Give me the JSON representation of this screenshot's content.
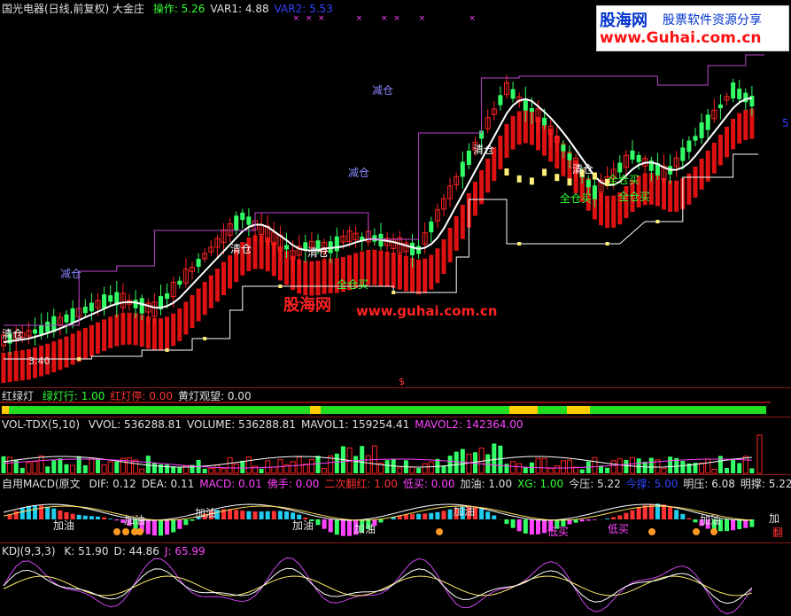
{
  "main_chart": {
    "title": "国光电器(日线,前复权) 大金庄",
    "indicators": [
      {
        "label": "操作: 5.26",
        "color": "#33ff33"
      },
      {
        "label": "VAR1: 4.88",
        "color": "#e0e0e0"
      },
      {
        "label": "VAR2: 5.53",
        "color": "#3344ff"
      }
    ],
    "right_price": "5",
    "low_marker": "3.40",
    "date_marker": "$",
    "annotations": [
      {
        "text": "清仓",
        "color": "#ffffff"
      },
      {
        "text": "减仓",
        "color": "#8888ff"
      },
      {
        "text": "清仓",
        "color": "#ffffff"
      },
      {
        "text": "清仓",
        "color": "#ffffff"
      },
      {
        "text": "全仓买",
        "color": "#33ff33"
      },
      {
        "text": "减仓",
        "color": "#8888ff"
      },
      {
        "text": "减仓",
        "color": "#8888ff"
      },
      {
        "text": "清仓",
        "color": "#ffffff"
      },
      {
        "text": "清仓",
        "color": "#ffffff"
      },
      {
        "text": "全仓买",
        "color": "#33ff33"
      },
      {
        "text": "全仓买",
        "color": "#33ff33"
      },
      {
        "text": "全仓买",
        "color": "#33ff33"
      }
    ]
  },
  "watermark": {
    "logo_cn": "股海网",
    "logo_slogan": "股票软件资源分享",
    "logo_url": "www.Guhai.com.cn",
    "center_cn": "股海网",
    "center_url": "www.guhai.com.cn"
  },
  "light_panel": {
    "title": "红绿灯",
    "items": [
      {
        "label": "绿灯行: 1.00",
        "color": "#33ff33"
      },
      {
        "label": "红灯停: 0.00",
        "color": "#ff3333"
      },
      {
        "label": "黄灯观望: 0.00",
        "color": "#e0e0e0"
      }
    ]
  },
  "vol_panel": {
    "title": "VOL-TDX(5,10)",
    "items": [
      {
        "label": "VVOL: 536288.81",
        "color": "#e0e0e0"
      },
      {
        "label": "VOLUME: 536288.81",
        "color": "#e0e0e0"
      },
      {
        "label": "MAVOL1: 159254.41",
        "color": "#e0e0e0"
      },
      {
        "label": "MAVOL2: 142364.00",
        "color": "#ff44ff"
      }
    ]
  },
  "macd_panel": {
    "title": "自用MACD(原文",
    "items": [
      {
        "label": "DIF: 0.12",
        "color": "#e0e0e0"
      },
      {
        "label": "DEA: 0.11",
        "color": "#e0e0e0"
      },
      {
        "label": "MACD: 0.01",
        "color": "#ff44ff"
      },
      {
        "label": "佛手: 0.00",
        "color": "#ff44ff"
      },
      {
        "label": "二次翻红: 1.00",
        "color": "#ff3333"
      },
      {
        "label": "低买: 0.00",
        "color": "#ff44ff"
      },
      {
        "label": "加油: 1.00",
        "color": "#e0e0e0"
      },
      {
        "label": "XG: 1.00",
        "color": "#33ff33"
      },
      {
        "label": "今压: 5.22",
        "color": "#e0e0e0"
      },
      {
        "label": "今撑: 5.00",
        "color": "#3344ff"
      },
      {
        "label": "明压: 6.08",
        "color": "#e0e0e0"
      },
      {
        "label": "明撑: 5.22",
        "color": "#e0e0e0"
      }
    ],
    "signals": [
      "加油",
      "加油",
      "加油",
      "加油",
      "加油",
      "加油",
      "加油",
      "加"
    ],
    "low_buy": [
      "低买",
      "低买"
    ],
    "right_tag": "翻"
  },
  "kdj_panel": {
    "title": "KDJ(9,3,3)",
    "items": [
      {
        "label": "K: 51.90",
        "color": "#e0e0e0"
      },
      {
        "label": "D: 44.86",
        "color": "#e0e0e0"
      },
      {
        "label": "J: 65.99",
        "color": "#ff44ff"
      }
    ]
  },
  "colors": {
    "bg": "#000000",
    "up": "#ff2222",
    "down": "#33ff66",
    "band": "#dd1111",
    "purple": "#bb44cc",
    "yellow": "#ffee77",
    "separator": "#8a1a1a"
  }
}
